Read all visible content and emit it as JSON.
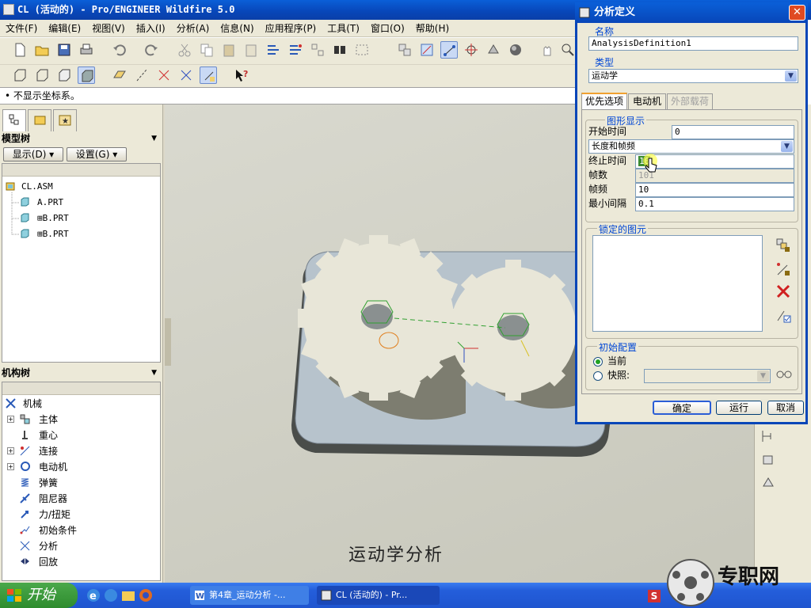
{
  "window": {
    "title": "CL (活动的) - Pro/ENGINEER Wildfire 5.0"
  },
  "menu": [
    "文件(F)",
    "编辑(E)",
    "视图(V)",
    "插入(I)",
    "分析(A)",
    "信息(N)",
    "应用程序(P)",
    "工具(T)",
    "窗口(O)",
    "帮助(H)"
  ],
  "status": {
    "message": "• 不显示坐标系。"
  },
  "model_tree": {
    "title": "模型树",
    "show_button": "显示(D) ▾",
    "settings_button": "设置(G) ▾",
    "items": [
      {
        "label": "CL.ASM",
        "icon": "assembly-icon",
        "level": 0
      },
      {
        "label": "A.PRT",
        "icon": "part-icon",
        "level": 1
      },
      {
        "label": "⊞B.PRT",
        "icon": "part-icon",
        "level": 1
      },
      {
        "label": "⊞B.PRT",
        "icon": "part-icon",
        "level": 1
      }
    ]
  },
  "mechanism_tree": {
    "title": "机构树",
    "items": [
      {
        "label": "机械",
        "icon": "mechanism-icon",
        "expand": false
      },
      {
        "label": "主体",
        "icon": "body-icon",
        "expand": true
      },
      {
        "label": "重心",
        "icon": "gravity-icon",
        "expand": false
      },
      {
        "label": "连接",
        "icon": "connection-icon",
        "expand": true
      },
      {
        "label": "电动机",
        "icon": "motor-icon",
        "expand": true
      },
      {
        "label": "弹簧",
        "icon": "spring-icon",
        "expand": false
      },
      {
        "label": "阻尼器",
        "icon": "damper-icon",
        "expand": false
      },
      {
        "label": "力/扭矩",
        "icon": "force-torque-icon",
        "expand": false
      },
      {
        "label": "初始条件",
        "icon": "initial-condition-icon",
        "expand": false
      },
      {
        "label": "分析",
        "icon": "analysis-icon",
        "expand": false
      },
      {
        "label": "回放",
        "icon": "playback-icon",
        "expand": false
      }
    ]
  },
  "viewport": {
    "caption": "运动学分析"
  },
  "dialog": {
    "title": "分析定义",
    "name_label": "名称",
    "name_value": "AnalysisDefinition1",
    "type_label": "类型",
    "type_value": "运动学",
    "tabs": [
      "优先选项",
      "电动机",
      "外部载荷"
    ],
    "graphics_group": "图形显示",
    "start_time_label": "开始时间",
    "start_time_value": "0",
    "mode_value": "长度和帧频",
    "end_time_label": "终止时间",
    "end_time_value": "10",
    "frames_label": "帧数",
    "frames_value": "101",
    "frame_rate_label": "帧频",
    "frame_rate_value": "10",
    "min_interval_label": "最小间隔",
    "min_interval_value": "0.1",
    "locked_group": "锁定的图元",
    "initial_group": "初始配置",
    "radio_current": "当前",
    "radio_snapshot": "快照:",
    "ok": "确定",
    "run": "运行",
    "cancel": "取消"
  },
  "taskbar": {
    "start": "开始",
    "tasks": [
      "第4章_运动分析 -...",
      "CL (活动的) - Pr..."
    ],
    "watermark": "专职网"
  },
  "colors": {
    "titlebar": "#0846b8",
    "chrome": "#ece9d8",
    "link_blue": "#0046d5"
  }
}
